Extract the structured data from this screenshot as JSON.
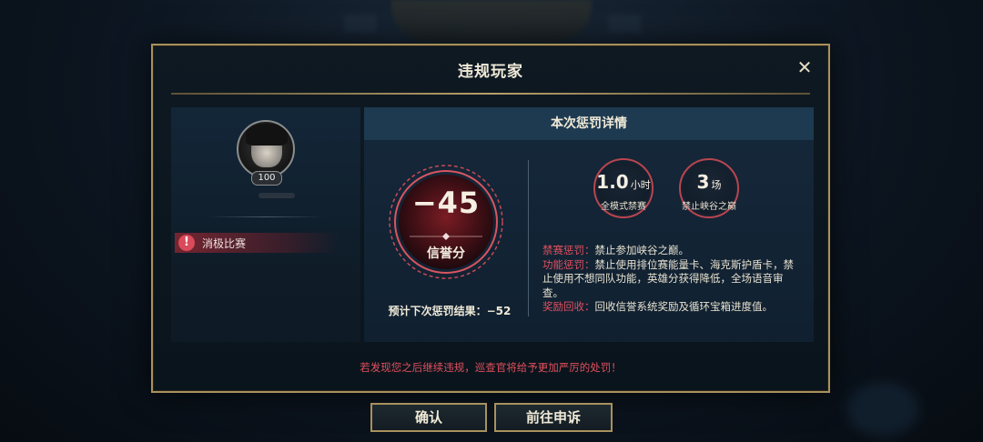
{
  "modal": {
    "title": "违规玩家",
    "close_icon": "close-icon"
  },
  "player": {
    "level": "100",
    "violation_label": "消极比赛",
    "warning_icon": "warning-icon"
  },
  "penalty": {
    "header": "本次惩罚详情",
    "score_value": "−45",
    "score_label": "信誉分",
    "next_penalty_text": "预计下次惩罚结果：−52",
    "stats": [
      {
        "value": "1.0",
        "unit": "小时",
        "label": "全模式禁赛"
      },
      {
        "value": "3",
        "unit": "场",
        "label": "禁止峡谷之巅"
      }
    ],
    "details": [
      {
        "key": "禁赛惩罚：",
        "text": "禁止参加峡谷之巅。"
      },
      {
        "key": "功能惩罚：",
        "text": "禁止使用排位赛能量卡、海克斯护盾卡，禁止使用不想同队功能，英雄分获得降低，全场语音审查。"
      },
      {
        "key": "奖励回收：",
        "text": "回收信誉系统奖励及循环宝箱进度值。"
      }
    ]
  },
  "warning_text": "若发现您之后继续违规，巡查官将给予更加严厉的处罚！",
  "buttons": {
    "confirm": "确认",
    "appeal": "前往申诉"
  },
  "colors": {
    "accent_gold": "#a8915d",
    "alert_red": "#e0505e",
    "panel_blue": "#1e3a50"
  }
}
